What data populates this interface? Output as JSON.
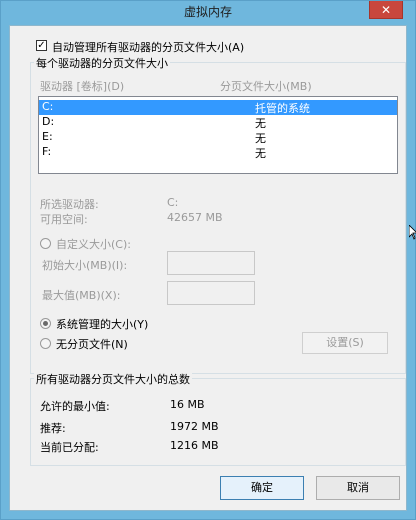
{
  "window": {
    "title": "虚拟内存",
    "close_glyph": "✕"
  },
  "auto_manage": {
    "checked": true,
    "label": "自动管理所有驱动器的分页文件大小(A)"
  },
  "per_drive": {
    "group_label": "每个驱动器的分页文件大小",
    "col_drive": "驱动器 [卷标](D)",
    "col_size": "分页文件大小(MB)",
    "rows": [
      {
        "drive": "C:",
        "size": "托管的系统",
        "selected": true
      },
      {
        "drive": "D:",
        "size": "无",
        "selected": false
      },
      {
        "drive": "E:",
        "size": "无",
        "selected": false
      },
      {
        "drive": "F:",
        "size": "无",
        "selected": false
      }
    ],
    "selected_drive_label": "所选驱动器:",
    "selected_drive_value": "C:",
    "free_space_label": "可用空间:",
    "free_space_value": "42657 MB",
    "custom_size_label": "自定义大小(C):",
    "initial_size_label": "初始大小(MB)(I):",
    "max_size_label": "最大值(MB)(X):",
    "system_managed_label": "系统管理的大小(Y)",
    "no_paging_label": "无分页文件(N)",
    "set_button": "设置(S)"
  },
  "totals": {
    "group_label": "所有驱动器分页文件大小的总数",
    "min_label": "允许的最小值:",
    "min_value": "16 MB",
    "recommended_label": "推荐:",
    "recommended_value": "1972 MB",
    "allocated_label": "当前已分配:",
    "allocated_value": "1216 MB"
  },
  "footer": {
    "ok": "确定",
    "cancel": "取消"
  }
}
